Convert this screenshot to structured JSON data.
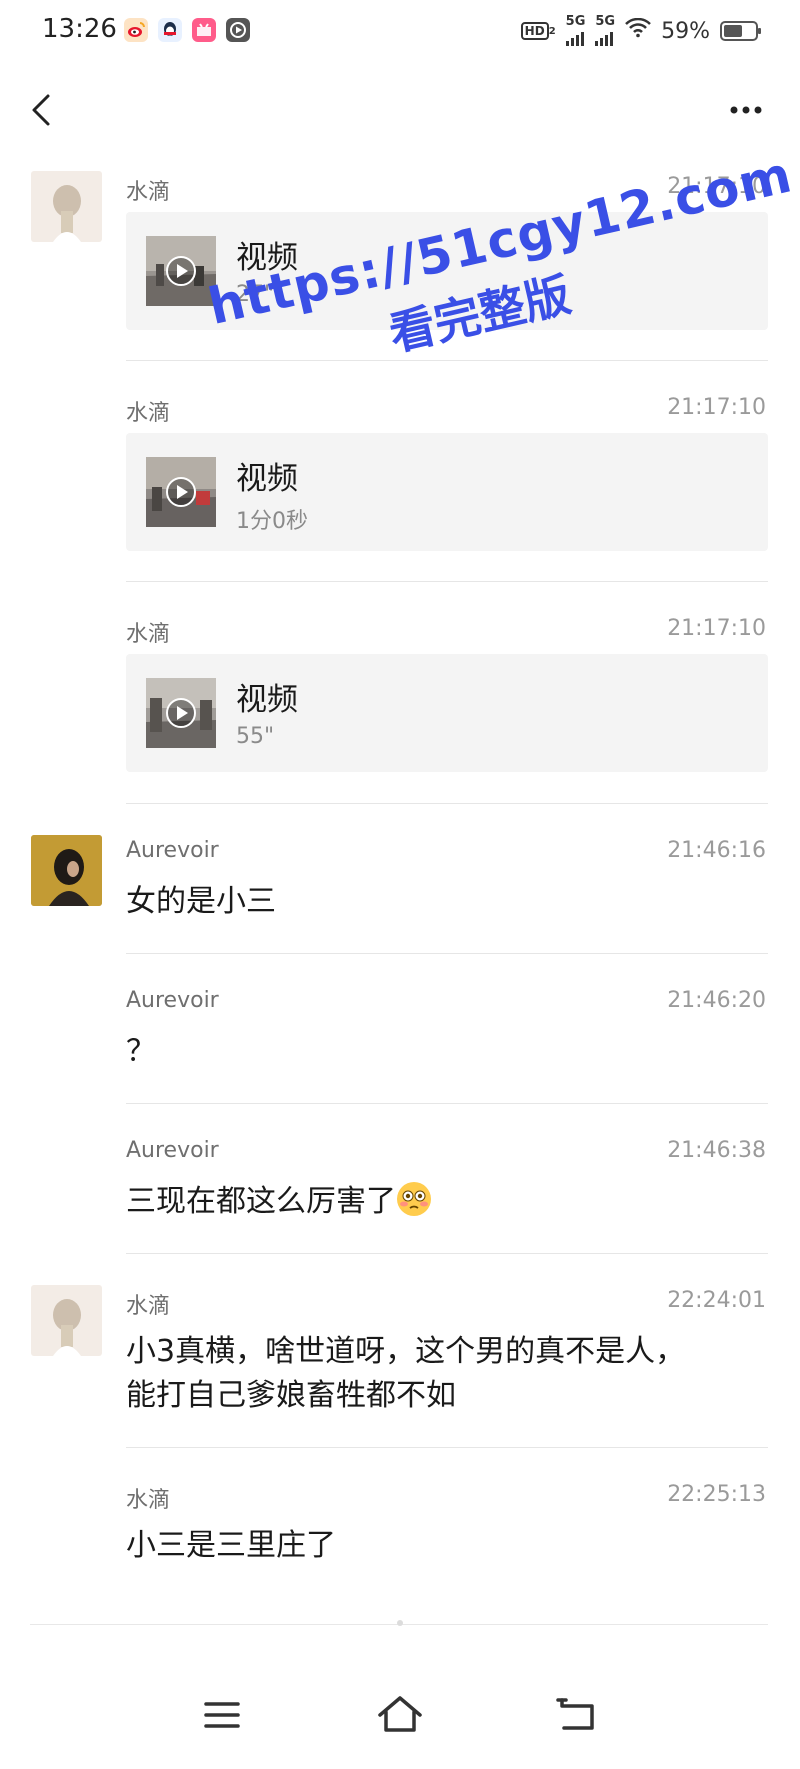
{
  "status_bar": {
    "time": "13:26",
    "network_badge": "HD",
    "network_badge_sub": "2",
    "signal_1_label": "5G",
    "signal_2_label": "5G",
    "battery_percent": "59%",
    "battery_level": 0.59,
    "app_icons": [
      "weibo-icon",
      "qq-icon",
      "pink-app-icon",
      "video-app-icon"
    ]
  },
  "header": {
    "back_icon": "chevron-left-icon",
    "more_icon": "more-dots-icon"
  },
  "messages": [
    {
      "sender": "水滴",
      "time": "21:17:10",
      "type": "video",
      "video_title": "视频",
      "video_duration": "27\""
    },
    {
      "sender": "水滴",
      "time": "21:17:10",
      "type": "video",
      "video_title": "视频",
      "video_duration": "1分0秒"
    },
    {
      "sender": "水滴",
      "time": "21:17:10",
      "type": "video",
      "video_title": "视频",
      "video_duration": "55\""
    },
    {
      "sender": "Aurevoir",
      "time": "21:46:16",
      "type": "text",
      "text": "女的是小三"
    },
    {
      "sender": "Aurevoir",
      "time": "21:46:20",
      "type": "text",
      "text": "？"
    },
    {
      "sender": "Aurevoir",
      "time": "21:46:38",
      "type": "text",
      "text": "三现在都这么厉害了",
      "emoji": "flushed-face-emoji"
    },
    {
      "sender": "水滴",
      "time": "22:24:01",
      "type": "text",
      "text_line1": "小3真横，啥世道呀，这个男的真不是人，",
      "text_line2": "能打自己爹娘畜牲都不如"
    },
    {
      "sender": "水滴",
      "time": "22:25:13",
      "type": "text",
      "text": "小三是三里庄了"
    }
  ],
  "watermark": {
    "line1": "https://51cgy12.com",
    "line2": "看完整版",
    "color": "#3a4fe6"
  },
  "nav_bar": {
    "menu_icon": "menu-icon",
    "home_icon": "home-icon",
    "back_icon": "back-arrow-icon"
  }
}
